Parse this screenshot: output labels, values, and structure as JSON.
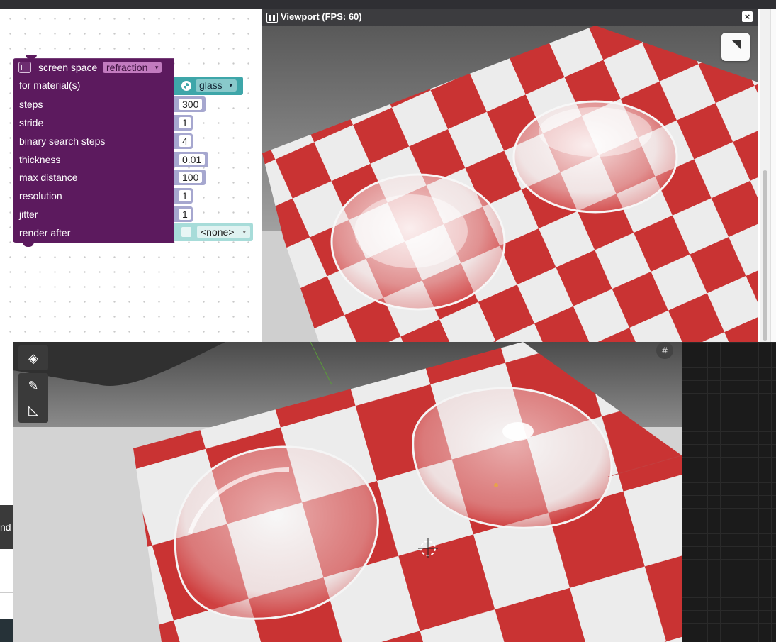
{
  "block": {
    "title": "screen space",
    "mode": "refraction",
    "dropdown_arrow": "▾",
    "icon": "camera-effect-icon",
    "colors": {
      "block": "#5c1a5e",
      "value": "#a6a7cf",
      "material": "#3ea6a9"
    },
    "rows": [
      {
        "label": "for material(s)"
      },
      {
        "label": "steps",
        "value": "300"
      },
      {
        "label": "stride",
        "value": "1"
      },
      {
        "label": "binary search steps",
        "value": "4"
      },
      {
        "label": "thickness",
        "value": "0.01"
      },
      {
        "label": "max distance",
        "value": "100"
      },
      {
        "label": "resolution",
        "value": "1"
      },
      {
        "label": "jitter",
        "value": "1"
      },
      {
        "label": "render after"
      }
    ],
    "material": {
      "value": "glass",
      "icon": "material-icon"
    },
    "render_after": {
      "value": "<none>",
      "icon": "cube-icon"
    }
  },
  "viewport": {
    "title": "Viewport (FPS: 60)",
    "close_label": "×",
    "pause_icon": "pause-icon",
    "expand_icon": "expand-icon"
  },
  "editor": {
    "tools": [
      "transform-gizmo-icon",
      "draw-icon",
      "measure-icon"
    ],
    "grid_toggle_icon": "grid-icon",
    "tooltip_fragment": "nd y",
    "colors": {
      "checker_red": "#c93333",
      "checker_white": "#ececec"
    }
  }
}
